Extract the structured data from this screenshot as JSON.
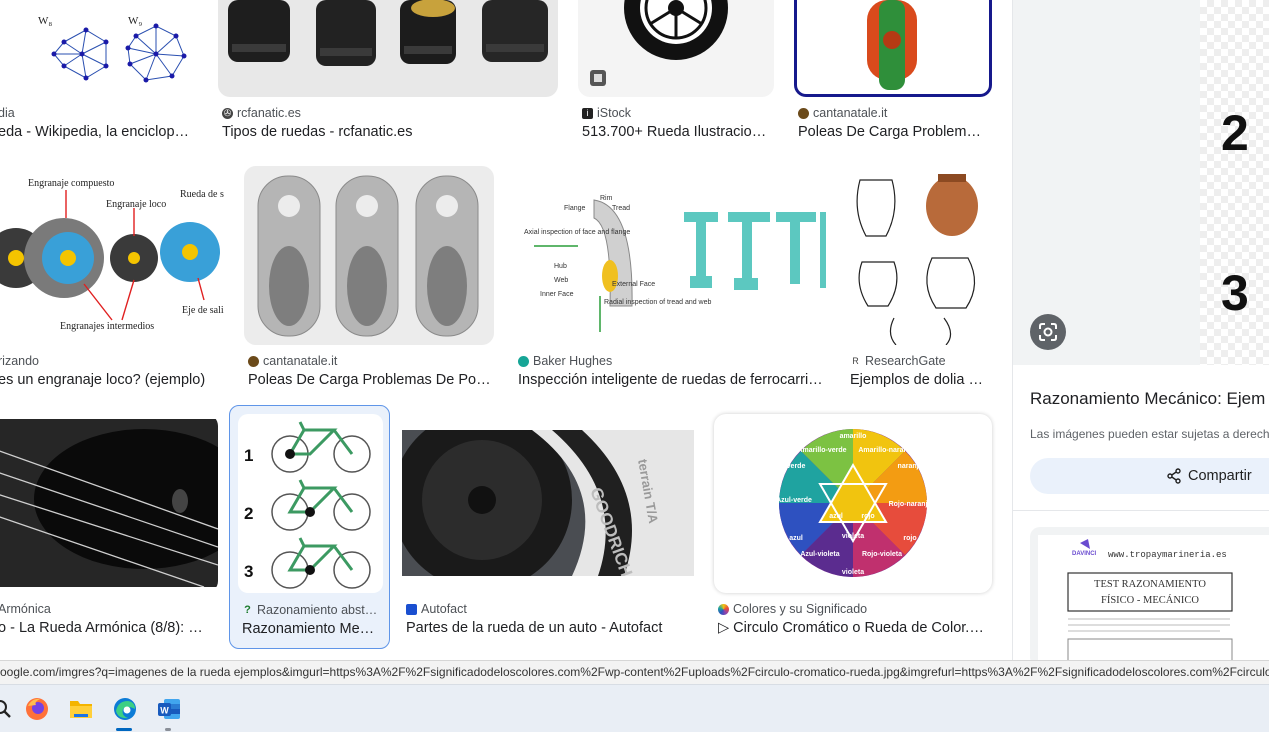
{
  "results": [
    {
      "source": "dia",
      "title": "eda - Wikipedia, la enciclop…",
      "thumb_labels": [
        "W₈",
        "W₉"
      ]
    },
    {
      "source": "rcfanatic.es",
      "title": "Tipos de ruedas - rcfanatic.es"
    },
    {
      "source": "iStock",
      "title": "513.700+ Rueda Ilustracio…"
    },
    {
      "source": "cantanatale.it",
      "title": "Poleas De Carga Problem…"
    },
    {
      "source": "rizando",
      "title": "es un engranaje loco? (ejemplo)",
      "thumb_labels": [
        "Engranaje compuesto",
        "Engranaje loco",
        "Rueda de s",
        "Eje de sali",
        "Engranajes intermedios"
      ]
    },
    {
      "source": "cantanatale.it",
      "title": "Poleas De Carga Problemas De Po…"
    },
    {
      "source": "Baker Hughes",
      "title": "Inspección inteligente de ruedas de ferrocarri…",
      "thumb_labels": [
        "Rim",
        "Flange",
        "Tread",
        "Axial inspection of face and flange",
        "Hub",
        "Web",
        "External Face",
        "Inner Face",
        "Radial inspection of tread and web"
      ]
    },
    {
      "source": "ResearchGate",
      "title": "Ejemplos de dolia …"
    },
    {
      "source": "Armónica",
      "title": "o - La Rueda Armónica (8/8): …"
    },
    {
      "source": "Razonamiento abst…",
      "title": "Razonamiento Me…",
      "thumb_labels": [
        "1",
        "2",
        "3"
      ]
    },
    {
      "source": "Autofact",
      "title": "Partes de la rueda de un auto - Autofact",
      "thumb_labels": [
        "GOODRICH",
        "terrain T/A"
      ]
    },
    {
      "source": "Colores y su Significado",
      "title": "▷ Circulo Cromático o Rueda de Color.…",
      "thumb_labels": [
        "amarillo",
        "Amarillo-verde",
        "Amarillo-naranja",
        "naranja",
        "verde",
        "Rojo-naranja",
        "Azul-verde",
        "azul",
        "rojo",
        "violeta",
        "Azul-violeta",
        "Rojo-violeta",
        "rojo",
        "azul",
        "violeta"
      ]
    }
  ],
  "panel": {
    "preview_numbers": [
      "2",
      "3"
    ],
    "title": "Razonamiento Mecánico: Ejem",
    "note": "Las imágenes pueden estar sujetas a derech",
    "share_label": "Compartir",
    "related": {
      "site": "www.tropaymarineria.es",
      "brand": "DAVINCI",
      "heading_1": "TEST RAZONAMIENTO",
      "heading_2": "FÍSICO - MECÁNICO"
    }
  },
  "status_url": "oogle.com/imgres?q=imagenes de la rueda ejemplos&imgurl=https%3A%2F%2Fsignificadodeloscolores.com%2Fwp-content%2Fuploads%2Fcirculo-cromatico-rueda.jpg&imgrefurl=https%3A%2F%2Fsignificadodeloscolores.com%2Fcirculo-c",
  "taskbar": {
    "apps": [
      "search",
      "firefox",
      "file-explorer",
      "edge",
      "word"
    ],
    "active": [
      "edge",
      "word"
    ]
  },
  "colors": {
    "accent": "#1a73e8",
    "selected_border": "#5f95e8",
    "taskbar_active": "#0067c0"
  }
}
